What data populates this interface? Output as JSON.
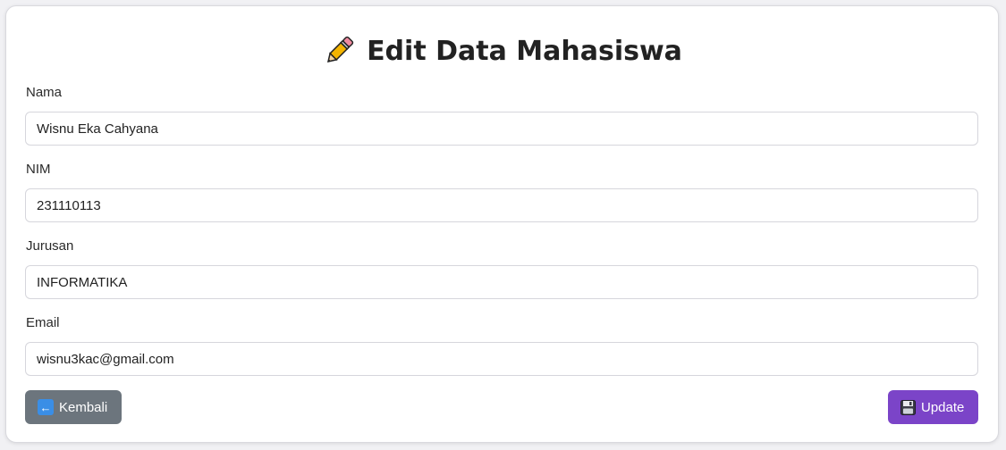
{
  "page": {
    "title": "Edit Data Mahasiswa",
    "title_icon": "pencil-icon"
  },
  "form": {
    "fields": [
      {
        "label": "Nama",
        "value": "Wisnu Eka Cahyana"
      },
      {
        "label": "NIM",
        "value": "231110113"
      },
      {
        "label": "Jurusan",
        "value": "INFORMATIKA"
      },
      {
        "label": "Email",
        "value": "wisnu3kac@gmail.com"
      }
    ]
  },
  "actions": {
    "back_label": "Kembali",
    "back_icon": "back-arrow-icon",
    "update_label": "Update",
    "update_icon": "floppy-disk-icon"
  },
  "colors": {
    "back_button": "#6c757d",
    "update_button": "#7b44c8",
    "card_background": "#ffffff"
  }
}
